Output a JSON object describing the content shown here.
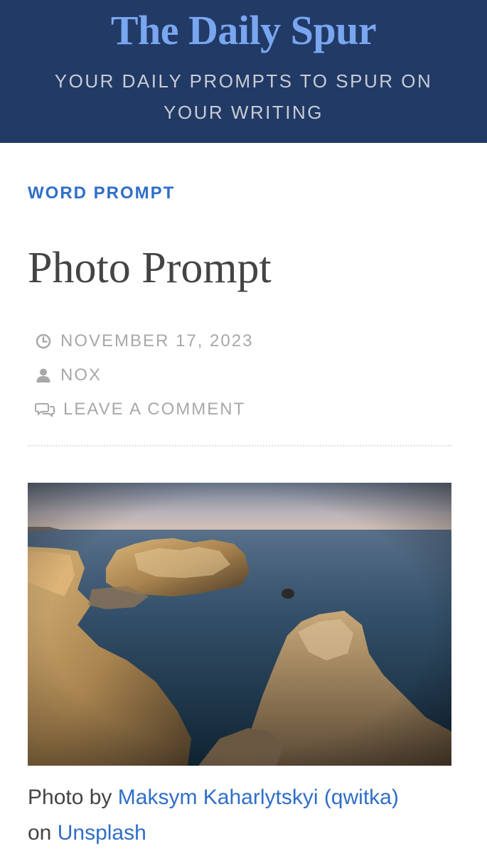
{
  "header": {
    "site_title": "The Daily Spur",
    "tagline": "YOUR DAILY PROMPTS TO SPUR ON YOUR WRITING"
  },
  "post": {
    "category": "WORD PROMPT",
    "title": "Photo Prompt",
    "meta": {
      "date": "NOVEMBER 17, 2023",
      "author": "NOX",
      "comment_link": "LEAVE A COMMENT"
    },
    "image_alt": "Rocky coastal cliffs and sea at dusk",
    "caption": {
      "prefix": "Photo by ",
      "author_link": "Maksym Kaharlytskyi (qwitka)",
      "middle": " on ",
      "source_link": "Unsplash"
    }
  },
  "icons": {
    "date": "clock-icon",
    "author": "user-icon",
    "comment": "comments-icon"
  },
  "colors": {
    "header_bg": "#213a66",
    "title_blue": "#7aa6f0",
    "link_blue": "#2f6ec8",
    "meta_gray": "#a8a8a8"
  }
}
